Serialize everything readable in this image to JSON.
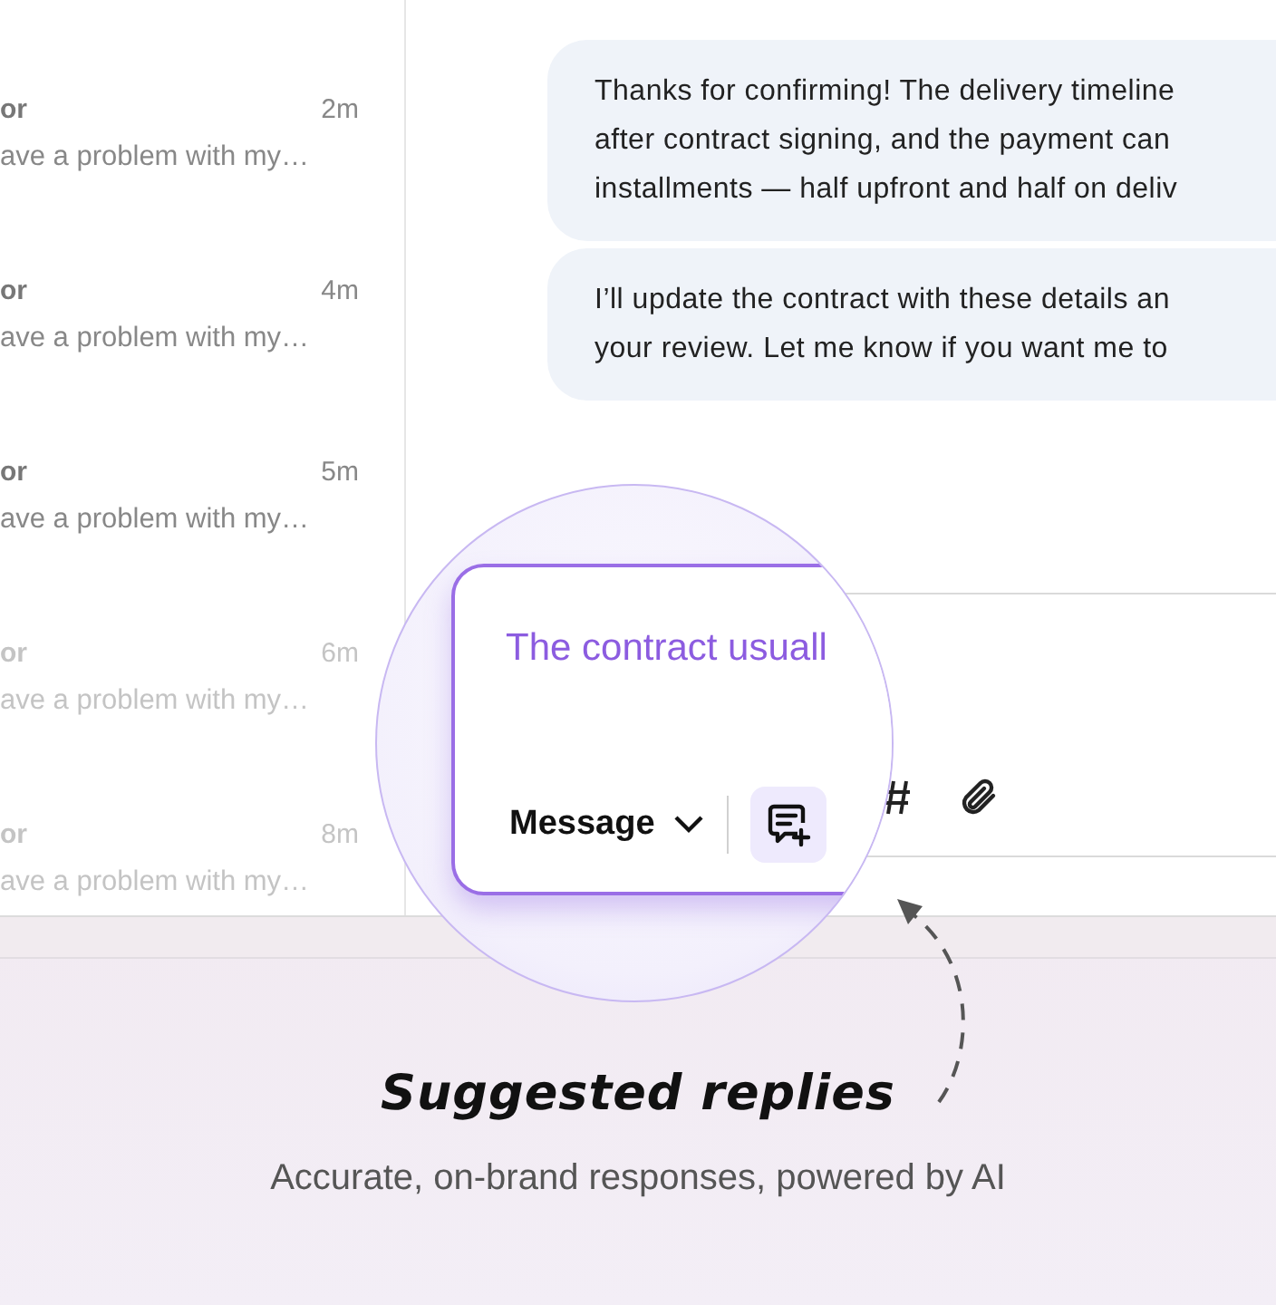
{
  "conversations": [
    {
      "name": "or",
      "time": "2m",
      "preview": "ave a problem with my…",
      "dimmed": false
    },
    {
      "name": "or",
      "time": "4m",
      "preview": "ave a problem with my…",
      "dimmed": false
    },
    {
      "name": "or",
      "time": "5m",
      "preview": "ave a problem with my…",
      "dimmed": false
    },
    {
      "name": "or",
      "time": "6m",
      "preview": "ave a problem with my…",
      "dimmed": true
    },
    {
      "name": "or",
      "time": "8m",
      "preview": "ave a problem with my…",
      "dimmed": true
    }
  ],
  "messages": [
    {
      "lines": [
        "Thanks for confirming! The delivery timeline",
        "after contract signing, and the payment can",
        "installments — half upfront and half on deliv"
      ]
    },
    {
      "lines": [
        "I’ll update the contract with these details an",
        "your review. Let me know if you want me to"
      ]
    }
  ],
  "composer": {
    "value": "The contract usuall",
    "mode": "Message"
  },
  "caption": {
    "title": "Suggested replies",
    "subtitle": "Accurate, on-brand responses, powered by AI"
  }
}
